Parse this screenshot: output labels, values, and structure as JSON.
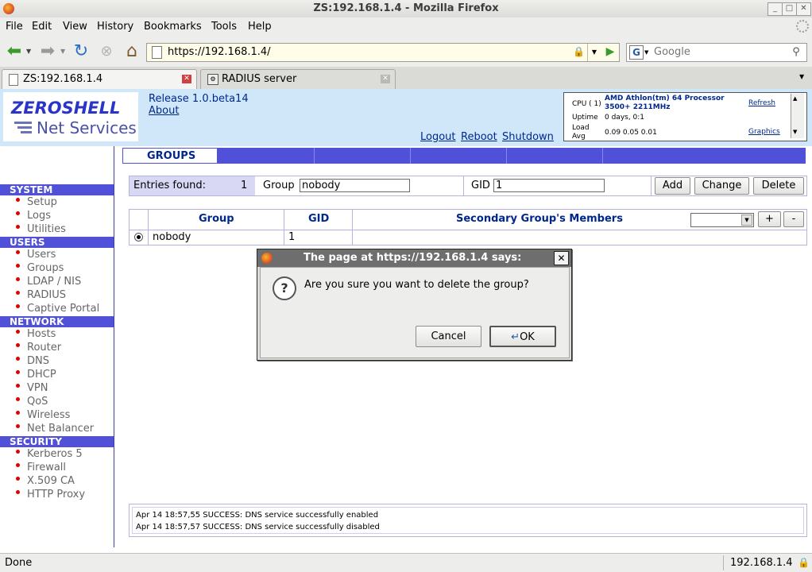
{
  "window": {
    "title": "ZS:192.168.1.4 - Mozilla Firefox"
  },
  "menu": [
    "File",
    "Edit",
    "View",
    "History",
    "Bookmarks",
    "Tools",
    "Help"
  ],
  "urlbar": {
    "value": "https://192.168.1.4/"
  },
  "search": {
    "placeholder": "Google"
  },
  "tabs": [
    {
      "label": "ZS:192.168.1.4",
      "active": true
    },
    {
      "label": "RADIUS server",
      "active": false
    }
  ],
  "header": {
    "logo_top": "ZEROSHELL",
    "logo_bottom": "Net Services",
    "release": "Release 1.0.beta14",
    "about": "About",
    "actions": [
      "Logout",
      "Reboot",
      "Shutdown"
    ],
    "cpu_label": "CPU ( 1)",
    "cpu_value": "AMD Athlon(tm) 64 Processor 3500+ 2211MHz",
    "uptime_label": "Uptime",
    "uptime_value": "0 days, 0:1",
    "load_label": "Load Avg",
    "load_value": "0.09 0.05 0.01",
    "refresh": "Refresh",
    "graphics": "Graphics"
  },
  "sidebar": {
    "sections": [
      {
        "title": "SYSTEM",
        "items": [
          "Setup",
          "Logs",
          "Utilities"
        ]
      },
      {
        "title": "USERS",
        "items": [
          "Users",
          "Groups",
          "LDAP / NIS",
          "RADIUS",
          "Captive Portal"
        ]
      },
      {
        "title": "NETWORK",
        "items": [
          "Hosts",
          "Router",
          "DNS",
          "DHCP",
          "VPN",
          "QoS",
          "Wireless",
          "Net Balancer"
        ]
      },
      {
        "title": "SECURITY",
        "items": [
          "Kerberos 5",
          "Firewall",
          "X.509 CA",
          "HTTP Proxy"
        ]
      }
    ]
  },
  "main": {
    "tab_label": "GROUPS",
    "entries_label": "Entries found:",
    "entries_count": "1",
    "group_label": "Group",
    "group_value": "nobody",
    "gid_label": "GID",
    "gid_value": "1",
    "buttons": {
      "add": "Add",
      "change": "Change",
      "delete": "Delete"
    },
    "table": {
      "headers": [
        "Group",
        "GID",
        "Secondary Group's Members"
      ],
      "rows": [
        {
          "group": "nobody",
          "gid": "1"
        }
      ],
      "plus": "+",
      "minus": "-"
    }
  },
  "log": [
    "Apr 14 18:57,55 SUCCESS: DNS service successfully enabled",
    "Apr 14 18:57,57 SUCCESS: DNS service successfully disabled"
  ],
  "statusbar": {
    "left": "Done",
    "right": "192.168.1.4"
  },
  "dialog": {
    "title": "The page at https://192.168.1.4 says:",
    "message": "Are you sure you want to delete the group?",
    "cancel": "Cancel",
    "ok": "OK"
  },
  "colors": {
    "nav_blue": "#5050d8",
    "header_bg": "#cfe7f8",
    "link": "#00288c",
    "bullet": "#e00000"
  }
}
